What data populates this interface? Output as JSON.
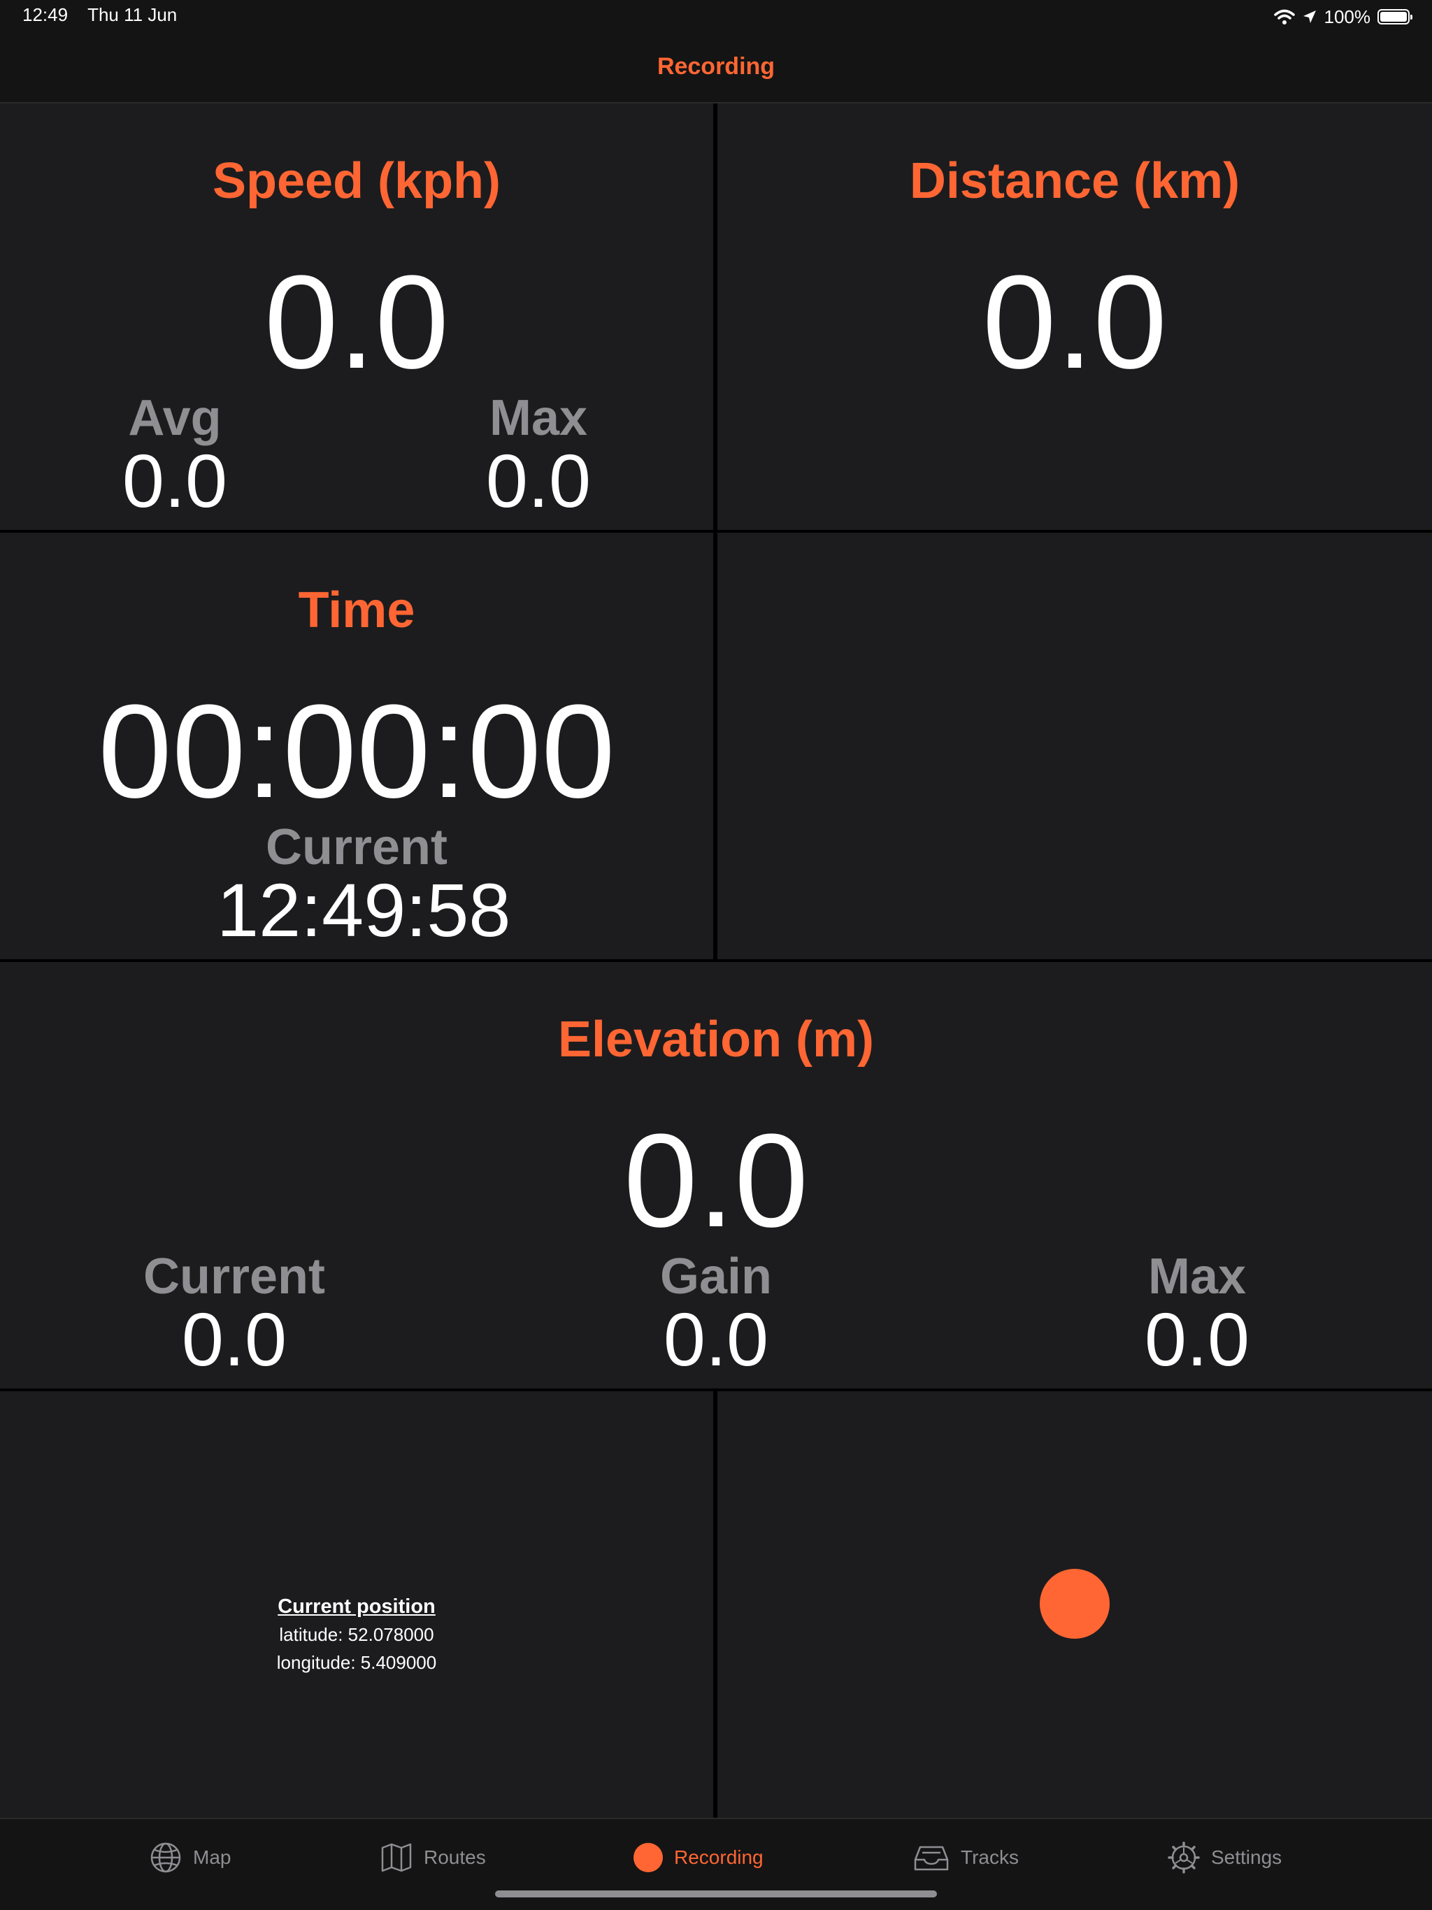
{
  "status": {
    "time": "12:49",
    "date": "Thu 11 Jun",
    "battery": "100%"
  },
  "nav": {
    "title": "Recording"
  },
  "speed": {
    "title": "Speed (kph)",
    "value": "0.0",
    "avg_label": "Avg",
    "avg_value": "0.0",
    "max_label": "Max",
    "max_value": "0.0"
  },
  "distance": {
    "title": "Distance (km)",
    "value": "0.0"
  },
  "time": {
    "title": "Time",
    "value": "00:00:00",
    "current_label": "Current",
    "current_value": "12:49:58"
  },
  "elevation": {
    "title": "Elevation (m)",
    "value": "0.0",
    "current_label": "Current",
    "current_value": "0.0",
    "gain_label": "Gain",
    "gain_value": "0.0",
    "max_label": "Max",
    "max_value": "0.0"
  },
  "position": {
    "title": "Current position",
    "latitude": "latitude: 52.078000",
    "longitude": "longitude: 5.409000"
  },
  "tabs": [
    {
      "label": "Map",
      "icon": "globe-icon"
    },
    {
      "label": "Routes",
      "icon": "map-icon"
    },
    {
      "label": "Recording",
      "icon": "record-dot-icon"
    },
    {
      "label": "Tracks",
      "icon": "tray-icon"
    },
    {
      "label": "Settings",
      "icon": "gear-icon"
    }
  ],
  "colors": {
    "accent": "#ff6633",
    "panel": "#1c1c1e",
    "secondary_text": "#8e8e93"
  }
}
